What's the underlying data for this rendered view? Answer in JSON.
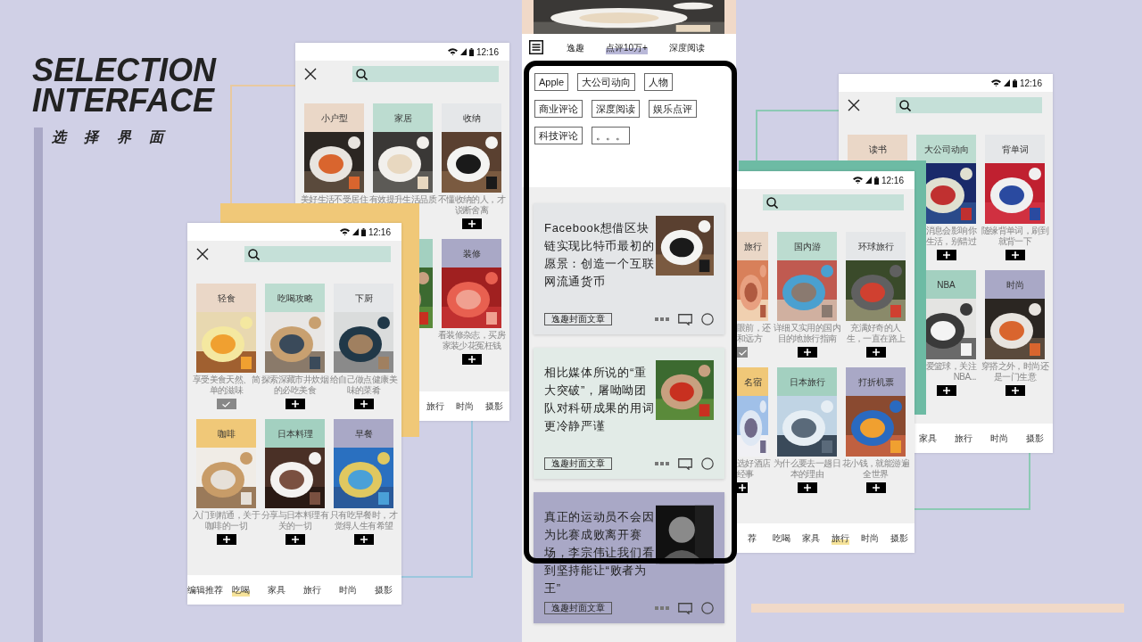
{
  "title": {
    "lines": [
      "SELECTION",
      "INTERFACE"
    ],
    "subtitle": "选 择 界 面"
  },
  "phones": [
    {
      "kind": "full",
      "time": "12:16",
      "rows": [
        [
          {
            "label": "小户型",
            "color": "#ead7c7",
            "desc": [
              "美好生活不受居住"
            ]
          },
          {
            "label": "家居",
            "color": "#bcdcd0",
            "desc": [
              "有效提升生活品质"
            ]
          },
          {
            "label": "收纳",
            "color": "#e5e7e9",
            "desc": [
              "不懂收纳的人，才",
              "说断舍离"
            ],
            "added": false
          }
        ],
        [
          "",
          {
            "color": "#a3d0c0"
          },
          {
            "label": "装修",
            "color": "#a9a8c6",
            "desc": [
              "看装修杂志，买房",
              "家装少花冤枉钱"
            ],
            "added": false
          }
        ]
      ],
      "nav": [
        {
          "label": "旅行",
          "selected": false
        },
        {
          "label": "时尚",
          "selected": false
        },
        {
          "label": "摄影",
          "selected": false
        }
      ]
    },
    {
      "kind": "full",
      "time": "12:16",
      "rows": [
        [
          {
            "label": "轻食",
            "color": "#ead7c7",
            "desc": [
              "享受美食天然、简",
              "单的滋味"
            ],
            "added": true
          },
          {
            "label": "吃喝攻略",
            "color": "#bcdcd0",
            "desc": [
              "探索深藏市井炊烟",
              "的必吃美食"
            ],
            "added": false
          },
          {
            "label": "下厨",
            "color": "#e5e7e9",
            "desc": [
              "给自己做点健康美",
              "味的菜肴"
            ],
            "added": false
          }
        ],
        [
          {
            "label": "咖啡",
            "color": "#f0c878",
            "desc": [
              "入门到精通，关于",
              "咖啡的一切"
            ],
            "added": false
          },
          {
            "label": "日本料理",
            "color": "#a3d0c0",
            "desc": [
              "分享与日本料理有",
              "关的一切"
            ],
            "added": false
          },
          {
            "label": "早餐",
            "color": "#a9a8c6",
            "desc": [
              "只有吃早餐时，才",
              "觉得人生有希望"
            ],
            "added": false
          }
        ]
      ],
      "nav": [
        {
          "label": "编辑推荐",
          "selected": false
        },
        {
          "label": "吃喝",
          "selected": true
        },
        {
          "label": "家具",
          "selected": false
        },
        {
          "label": "旅行",
          "selected": false
        },
        {
          "label": "时尚",
          "selected": false
        },
        {
          "label": "摄影",
          "selected": false
        }
      ]
    },
    {
      "kind": "cropped",
      "time": "12:16",
      "rows": [
        [
          {
            "label": "旅行",
            "color": "#ead7c7",
            "desc": [
              "眼前，还",
              "和远方"
            ],
            "added": true
          },
          {
            "label": "国内游",
            "color": "#bcdcd0",
            "desc": [
              "详细又实用的国内",
              "目的地旅行指南"
            ],
            "added": false
          },
          {
            "label": "环球旅行",
            "color": "#e5e7e9",
            "desc": [
              "充满好奇的人",
              "生，一直在路上"
            ],
            "added": false
          }
        ],
        [
          {
            "label": "名宿",
            "color": "#f0c878",
            "desc": [
              "选好酒店",
              "经事"
            ],
            "added": false
          },
          {
            "label": "日本旅行",
            "color": "#a3d0c0",
            "desc": [
              "为什么要去一趟日",
              "本的理由"
            ],
            "added": false
          },
          {
            "label": "打折机票",
            "color": "#a9a8c6",
            "desc": [
              "花小钱，就能游遍",
              "全世界"
            ],
            "added": false
          }
        ]
      ],
      "nav": [
        {
          "label": "荐",
          "selected": false
        },
        {
          "label": "吃喝",
          "selected": false
        },
        {
          "label": "家具",
          "selected": false
        },
        {
          "label": "旅行",
          "selected": true
        },
        {
          "label": "时尚",
          "selected": false
        },
        {
          "label": "摄影",
          "selected": false
        }
      ]
    },
    {
      "kind": "full",
      "time": "12:16",
      "rows": [
        [
          {
            "kind": "stub",
            "label": "读书",
            "color": "#ead7c7"
          },
          {
            "kind": "card",
            "label": "大公司动向",
            "color": "#bcdcd0",
            "desc": [
              "消息会影响你",
              "生活，别错过"
            ],
            "added": false
          },
          {
            "kind": "card",
            "label": "背单词",
            "color": "#e5e7e9",
            "desc": [
              "随缘背单词，刷到",
              "就背一下"
            ],
            "added": false
          }
        ],
        [
          "",
          {
            "kind": "card",
            "label": "NBA",
            "color": "#a3d0c0",
            "desc": [
              "爱篮球，关注",
              "NBA..."
            ],
            "added": false
          },
          {
            "kind": "card",
            "label": "时尚",
            "color": "#a9a8c6",
            "desc": [
              "穿搭之外，时尚还",
              "是一门生意"
            ],
            "added": false
          }
        ]
      ],
      "nav": [
        {
          "label": "家具",
          "selected": false
        },
        {
          "label": "旅行",
          "selected": false
        },
        {
          "label": "时尚",
          "selected": false
        },
        {
          "label": "摄影",
          "selected": false
        }
      ]
    }
  ],
  "reader": {
    "tabs": [
      {
        "label": "逸趣",
        "selected": false
      },
      {
        "label": "点评10万+",
        "selected": true
      },
      {
        "label": "深度阅读",
        "selected": false
      }
    ],
    "tags": [
      "Apple",
      "大公司动向",
      "人物",
      "商业评论",
      "深度阅读",
      "娱乐点评",
      "科技评论",
      "。。。"
    ],
    "articles": [
      {
        "title": "Facebook想借区块链实现比特币最初的愿景：创造一个互联网流通货币",
        "color": "#e4e6e8",
        "tag": "逸趣封面文章"
      },
      {
        "title": "相比媒体所说的“重大突破”，屠呦呦团队对科研成果的用词更冷静严谨",
        "color": "#e2ebe7",
        "tag": "逸趣封面文章"
      },
      {
        "title": "真正的运动员不会因为比赛成败离开赛场，李宗伟让我们看到坚持能让“败者为王”",
        "color": "#a9a8c6",
        "tag": "逸趣封面文章"
      }
    ]
  }
}
